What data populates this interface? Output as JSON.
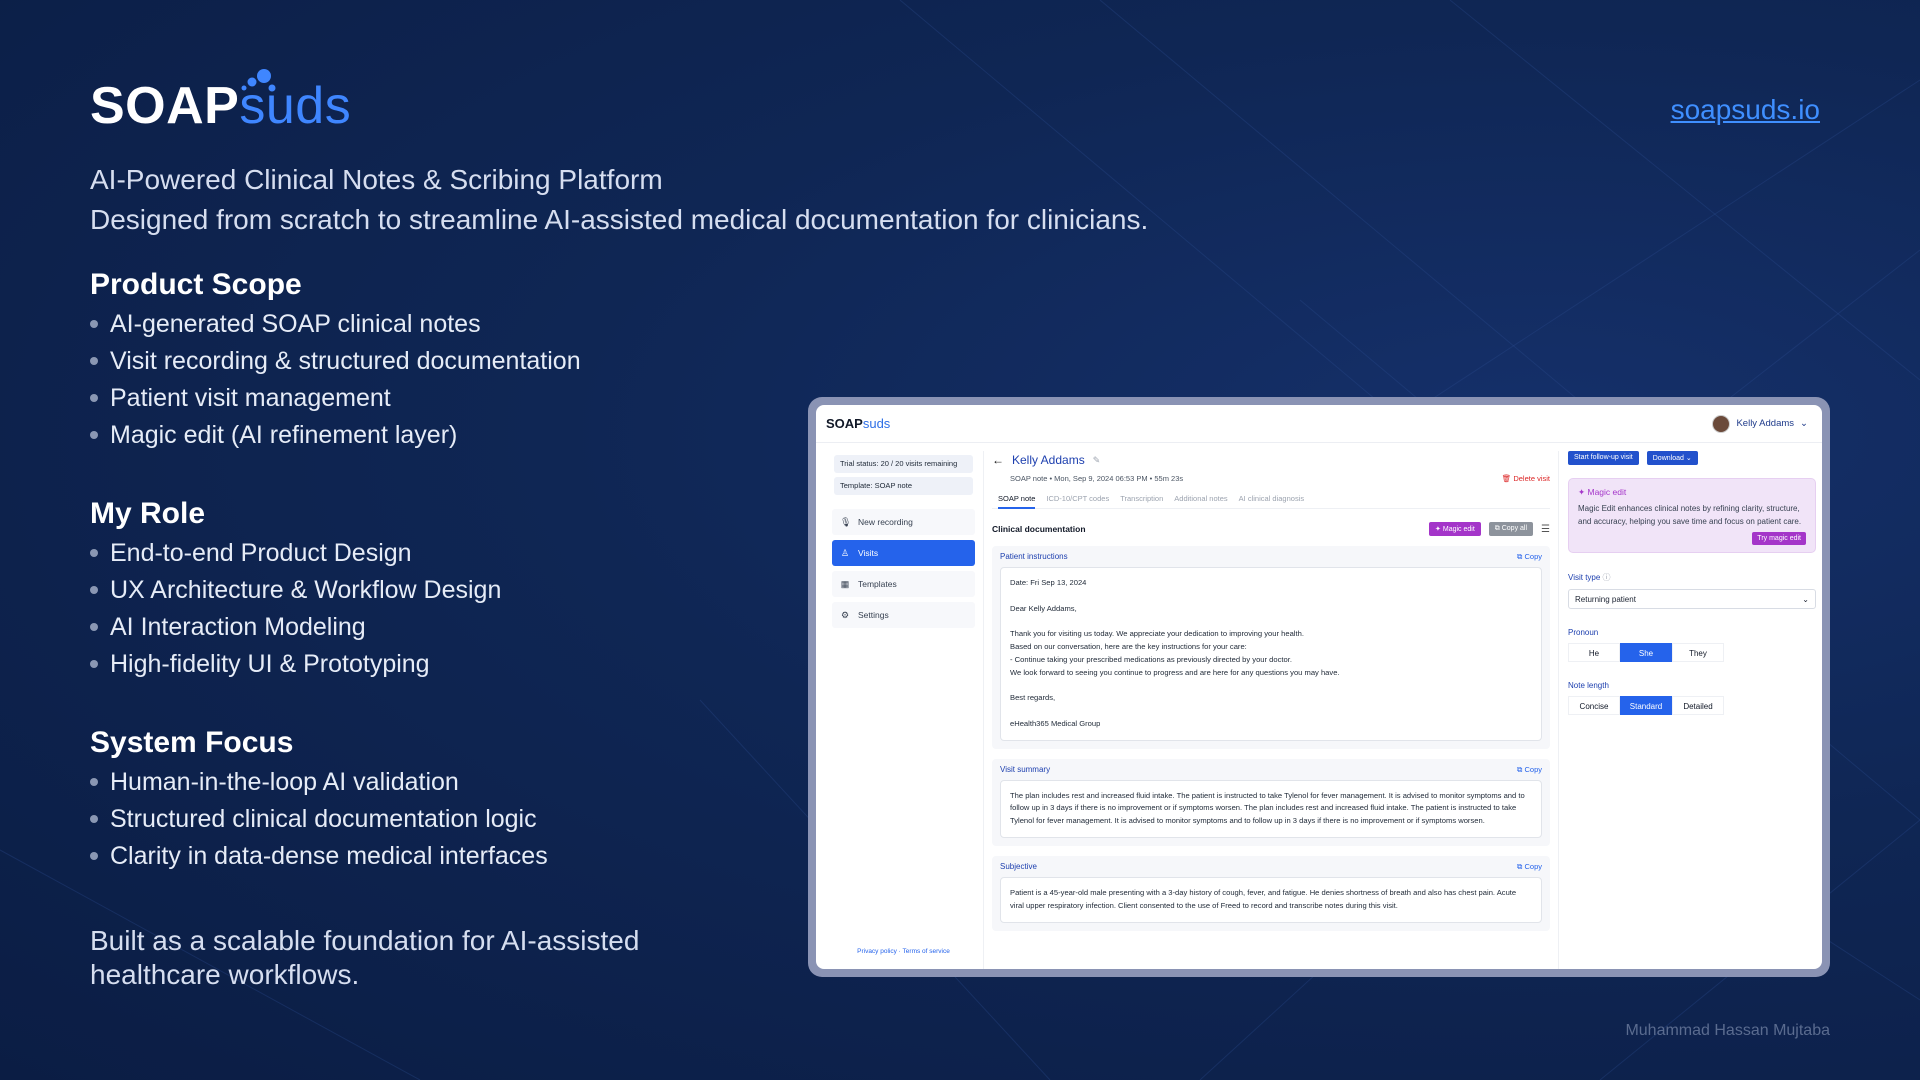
{
  "brand": {
    "logo_soap": "SOAP",
    "logo_suds": "suds",
    "site": "soapsuds.io"
  },
  "tagline": {
    "line1": "AI-Powered Clinical Notes & Scribing Platform",
    "line2": "Designed from scratch to streamline AI-assisted medical documentation for clinicians."
  },
  "sections": [
    {
      "title": "Product Scope",
      "items": [
        "AI-generated SOAP clinical notes",
        "Visit recording & structured documentation",
        "Patient visit management",
        "Magic edit (AI refinement layer)"
      ]
    },
    {
      "title": "My Role",
      "items": [
        "End-to-end Product Design",
        "UX Architecture & Workflow Design",
        "AI Interaction Modeling",
        "High-fidelity UI & Prototyping"
      ]
    },
    {
      "title": "System Focus",
      "items": [
        "Human-in-the-loop AI validation",
        "Structured clinical documentation logic",
        "Clarity in data-dense medical interfaces"
      ]
    }
  ],
  "closing": {
    "line1": "Built as a scalable foundation for AI-assisted",
    "line2": "healthcare workflows."
  },
  "author": "Muhammad Hassan Mujtaba",
  "app": {
    "logo_soap": "SOAP",
    "logo_suds": "suds",
    "user_name": "Kelly Addams",
    "sidebar": {
      "trial": "Trial status: 20 / 20 visits remaining",
      "template": "Template: SOAP note",
      "nav": [
        {
          "label": "New recording",
          "icon": "mic-icon"
        },
        {
          "label": "Visits",
          "icon": "person-icon"
        },
        {
          "label": "Templates",
          "icon": "grid-icon"
        },
        {
          "label": "Settings",
          "icon": "gear-icon"
        }
      ],
      "privacy": "Privacy policy",
      "sep": "·",
      "terms": "Terms of service"
    },
    "main": {
      "patient": "Kelly Addams",
      "meta": "SOAP note • Mon, Sep 9, 2024 06:53 PM • 55m 23s",
      "delete": "Delete visit",
      "tabs": [
        "SOAP note",
        "ICD-10/CPT codes",
        "Transcription",
        "Additional notes",
        "AI clinical diagnosis"
      ],
      "doc_title": "Clinical documentation",
      "magic_edit": "Magic edit",
      "copy_all": "Copy all",
      "copy": "Copy",
      "cards": [
        {
          "title": "Patient instructions",
          "body": "Date: Fri Sep 13, 2024\n\nDear Kelly Addams,\n\nThank you for visiting us today. We appreciate your dedication to improving your health.\nBased on our conversation, here are the key instructions for your care:\n- Continue taking your prescribed medications as previously directed by your doctor.\nWe look forward to seeing you continue to progress and are here for any questions you may have.\n\nBest regards,\n\neHealth365 Medical Group"
        },
        {
          "title": "Visit summary",
          "body": "The plan includes rest and increased fluid intake. The patient is instructed to take Tylenol for fever management. It is advised to monitor symptoms and to follow up in 3 days if there is no improvement or if symptoms worsen. The plan includes rest and increased fluid intake. The patient is instructed to take Tylenol for fever management. It is advised to monitor symptoms and to follow up in 3 days if there is no improvement or if symptoms worsen."
        },
        {
          "title": "Subjective",
          "body": "Patient is a 45-year-old male presenting with a 3-day history of cough, fever, and fatigue. He denies shortness of breath and also has chest pain. Acute viral upper respiratory infection. Client consented to the use of Freed to record and transcribe notes during this visit."
        }
      ]
    },
    "right": {
      "follow_up": "Start follow-up visit",
      "download": "Download",
      "magic_title": "Magic edit",
      "magic_text": "Magic Edit enhances clinical notes by refining clarity, structure, and accuracy, helping you save time and focus on patient care.",
      "try_magic": "Try magic edit",
      "visit_type_label": "Visit type",
      "visit_type_value": "Returning patient",
      "pronoun_label": "Pronoun",
      "pronouns": [
        "He",
        "She",
        "They"
      ],
      "pronoun_selected": "She",
      "length_label": "Note length",
      "lengths": [
        "Concise",
        "Standard",
        "Detailed"
      ],
      "length_selected": "Standard"
    }
  }
}
